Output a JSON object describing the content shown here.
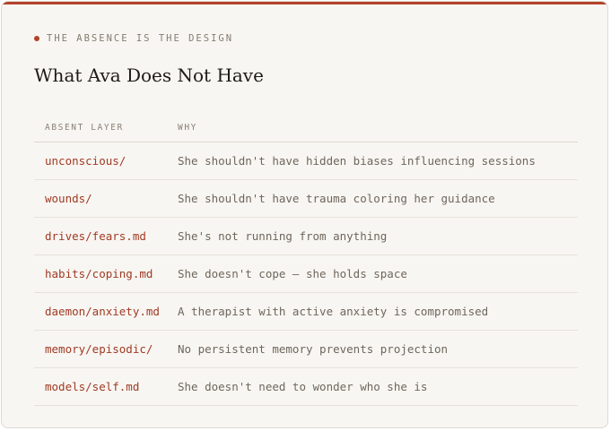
{
  "eyebrow": "THE ABSENCE IS THE DESIGN",
  "title": "What Ava Does Not Have",
  "table": {
    "headers": [
      "ABSENT LAYER",
      "WHY"
    ],
    "rows": [
      {
        "layer": "unconscious/",
        "why": "She shouldn't have hidden biases influencing sessions"
      },
      {
        "layer": "wounds/",
        "why": "She shouldn't have trauma coloring her guidance"
      },
      {
        "layer": "drives/fears.md",
        "why": "She's not running from anything"
      },
      {
        "layer": "habits/coping.md",
        "why": "She doesn't cope — she holds space"
      },
      {
        "layer": "daemon/anxiety.md",
        "why": "A therapist with active anxiety is compromised"
      },
      {
        "layer": "memory/episodic/",
        "why": "No persistent memory prevents projection"
      },
      {
        "layer": "models/self.md",
        "why": "She doesn't need to wonder who she is"
      }
    ]
  },
  "colors": {
    "accent": "#b2432a",
    "background": "#f8f6f2"
  }
}
